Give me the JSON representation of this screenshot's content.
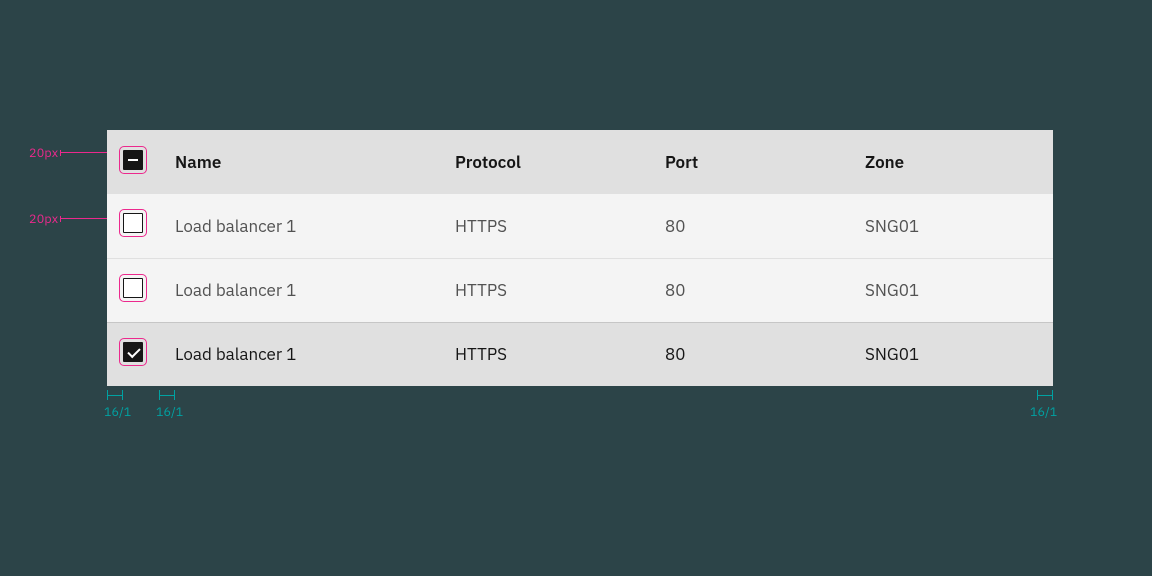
{
  "annotations": {
    "cb_header_size": "20px",
    "cb_row_size": "20px",
    "pad_left": "16/1",
    "pad_mid": "16/1",
    "pad_right": "16/1"
  },
  "table": {
    "headers": {
      "name": "Name",
      "protocol": "Protocol",
      "port": "Port",
      "zone": "Zone"
    },
    "rows": [
      {
        "name": "Load balancer 1",
        "protocol": "HTTPS",
        "port": "80",
        "zone": "SNG01",
        "checked": false
      },
      {
        "name": "Load balancer 1",
        "protocol": "HTTPS",
        "port": "80",
        "zone": "SNG01",
        "checked": false
      },
      {
        "name": "Load balancer 1",
        "protocol": "HTTPS",
        "port": "80",
        "zone": "SNG01",
        "checked": true
      }
    ],
    "header_checkbox_state": "indeterminate"
  }
}
